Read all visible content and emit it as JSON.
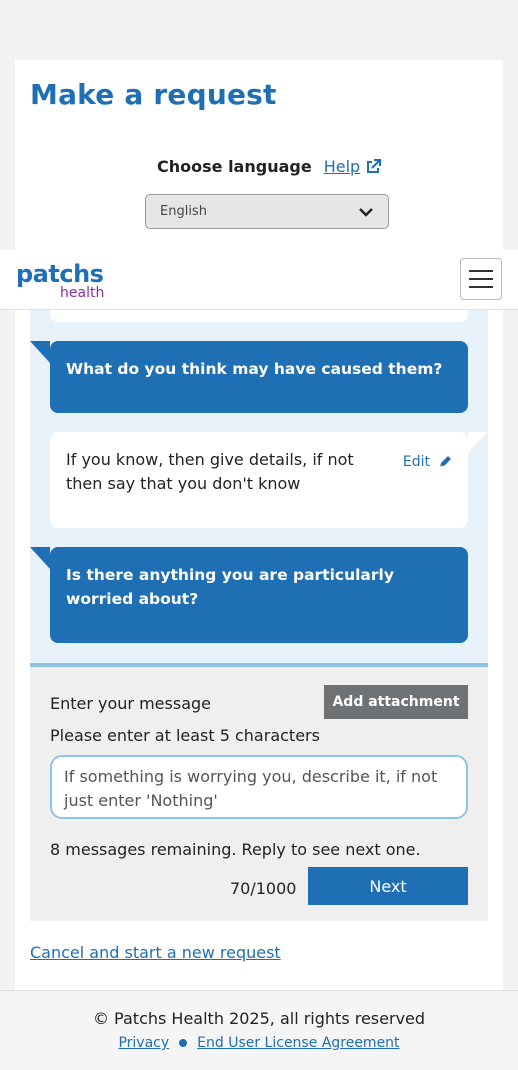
{
  "page": {
    "title": "Make a request"
  },
  "language": {
    "label": "Choose language",
    "help_label": "Help",
    "selected": "English"
  },
  "navbar": {
    "logo_top": "patchs",
    "logo_bottom": "health"
  },
  "conversation": {
    "questions": [
      {
        "text": "What do you think may have caused them?"
      },
      {
        "text": "Is there anything you are particularly worried about?"
      }
    ],
    "answers": [
      {
        "text": "If you know, then give details, if not then say that you don't know",
        "edit_label": "Edit"
      }
    ]
  },
  "composer": {
    "enter_label": "Enter your message",
    "attach_label": "Add attachment",
    "hint": "Please enter at least 5 characters",
    "message_value": "If something is worrying you, describe it, if not just enter 'Nothing'",
    "remaining": "8 messages remaining. Reply to see next one.",
    "counter": "70/1000",
    "next_label": "Next"
  },
  "cancel_link": "Cancel and start a new request",
  "footer": {
    "copyright": "© Patchs Health 2025, all rights reserved",
    "privacy": "Privacy",
    "eula": "End User License Agreement"
  },
  "colors": {
    "brand_blue": "#1f6fb5",
    "brand_purple": "#8b2fa0",
    "composer_border": "#8ec3e8"
  }
}
